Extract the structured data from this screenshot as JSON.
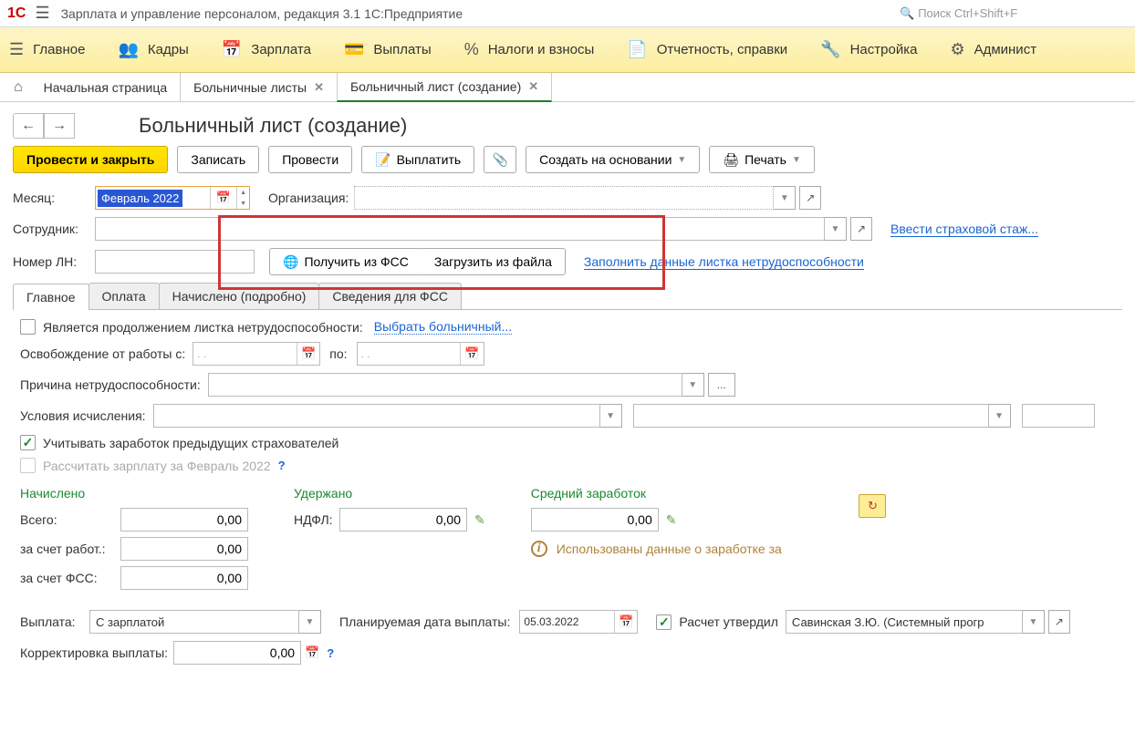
{
  "titlebar": {
    "title": "Зарплата и управление персоналом, редакция 3.1 1С:Предприятие",
    "search_placeholder": "Поиск Ctrl+Shift+F"
  },
  "mainnav": {
    "items": [
      {
        "label": "Главное"
      },
      {
        "label": "Кадры"
      },
      {
        "label": "Зарплата"
      },
      {
        "label": "Выплаты"
      },
      {
        "label": "Налоги и взносы"
      },
      {
        "label": "Отчетность, справки"
      },
      {
        "label": "Настройка"
      },
      {
        "label": "Админист"
      }
    ]
  },
  "tabs": {
    "home": "Начальная страница",
    "t1": "Больничные листы",
    "t2": "Больничный лист (создание)"
  },
  "page": {
    "title": "Больничный лист (создание)"
  },
  "toolbar": {
    "post_close": "Провести и закрыть",
    "write": "Записать",
    "post": "Провести",
    "pay": "Выплатить",
    "create_basis": "Создать на основании",
    "print": "Печать"
  },
  "form": {
    "month_label": "Месяц:",
    "month_value": "Февраль 2022",
    "org_label": "Организация:",
    "emp_label": "Сотрудник:",
    "ins_link": "Ввести страховой стаж...",
    "ln_label": "Номер ЛН:",
    "get_fss": "Получить из ФСС",
    "load_file": "Загрузить из файла",
    "fill_link": "Заполнить данные листка нетрудоспособности"
  },
  "subtabs": {
    "t0": "Главное",
    "t1": "Оплата",
    "t2": "Начислено (подробно)",
    "t3": "Сведения для ФСС"
  },
  "main_tab": {
    "continuation_label": "Является продолжением листка нетрудоспособности:",
    "choose_sick": "Выбрать больничный...",
    "release_label": "Освобождение от работы с:",
    "to_label": "по:",
    "date_placeholder": ".   .",
    "reason_label": "Причина нетрудоспособности:",
    "calc_cond_label": "Условия исчисления:",
    "prev_insurers_label": "Учитывать заработок предыдущих страхователей",
    "recalc_salary_label": "Рассчитать зарплату за Февраль 2022",
    "accrued_hdr": "Начислено",
    "total_label": "Всего:",
    "by_employer_label": "за счет работ.:",
    "by_fss_label": "за счет ФСС:",
    "zero": "0,00",
    "withheld_hdr": "Удержано",
    "ndfl_label": "НДФЛ:",
    "avg_hdr": "Средний заработок",
    "info_msg": "Использованы данные о заработке за",
    "payout_label": "Выплата:",
    "payout_value": "С зарплатой",
    "plan_date_label": "Планируемая дата выплаты:",
    "plan_date_value": "05.03.2022",
    "approved_label": "Расчет утвердил",
    "approved_value": "Савинская З.Ю. (Системный прогр",
    "corr_label": "Корректировка выплаты:",
    "corr_value": "0,00"
  }
}
